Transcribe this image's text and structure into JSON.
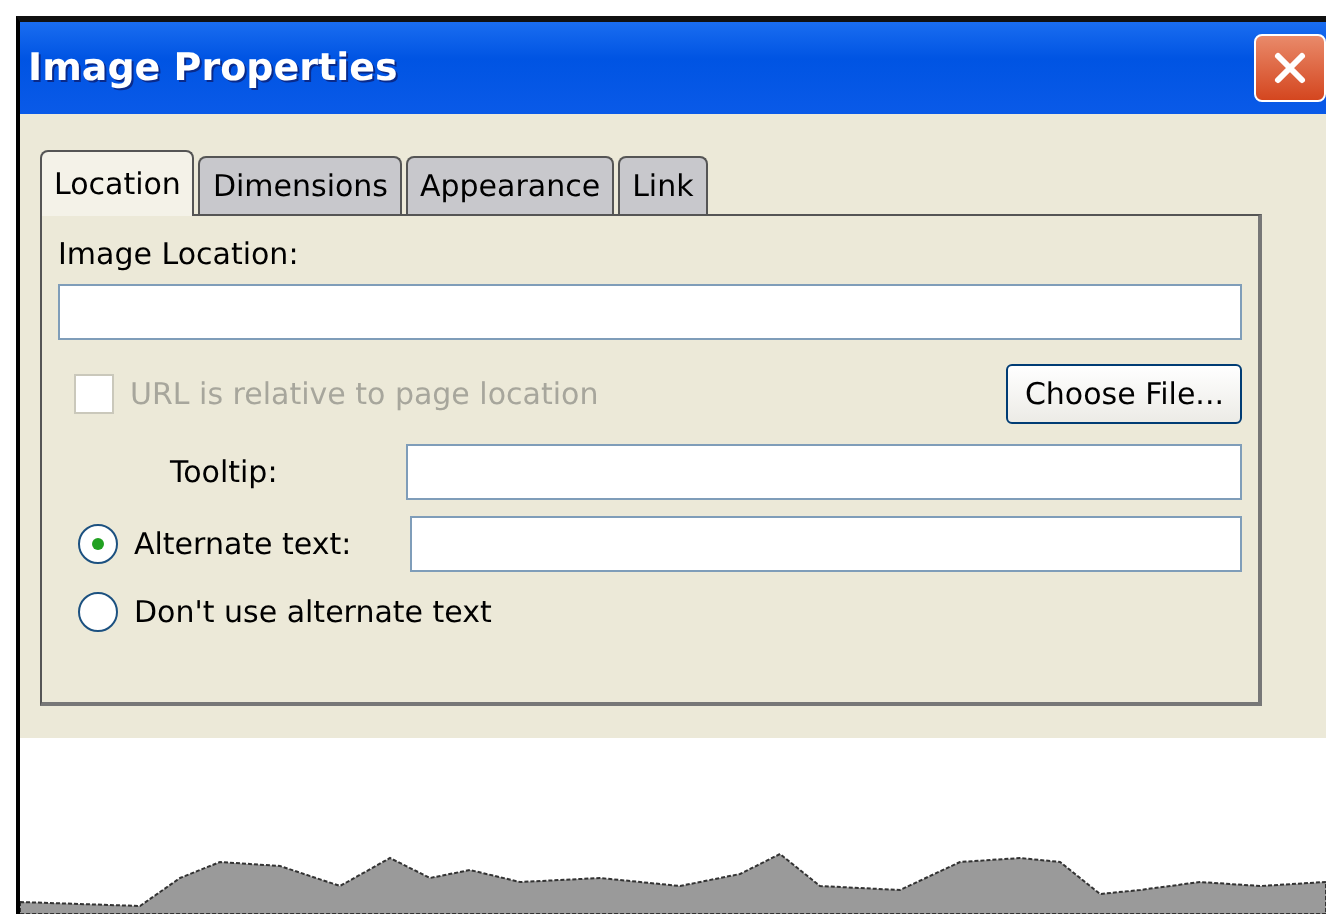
{
  "window": {
    "title": "Image Properties"
  },
  "tabs": [
    {
      "label": "Location",
      "selected": true
    },
    {
      "label": "Dimensions",
      "selected": false
    },
    {
      "label": "Appearance",
      "selected": false
    },
    {
      "label": "Link",
      "selected": false
    }
  ],
  "image_location": {
    "label": "Image Location:"
  },
  "relative_url": {
    "label": "URL is relative to page location",
    "checked": false,
    "disabled": true
  },
  "choose_file_button": "Choose File...",
  "tooltip": {
    "label": "Tooltip:"
  },
  "alt_options": [
    {
      "label": "Alternate text:",
      "selected": true,
      "kind": "field"
    },
    {
      "label": "Don't use alternate text",
      "selected": false,
      "kind": "plain"
    }
  ]
}
